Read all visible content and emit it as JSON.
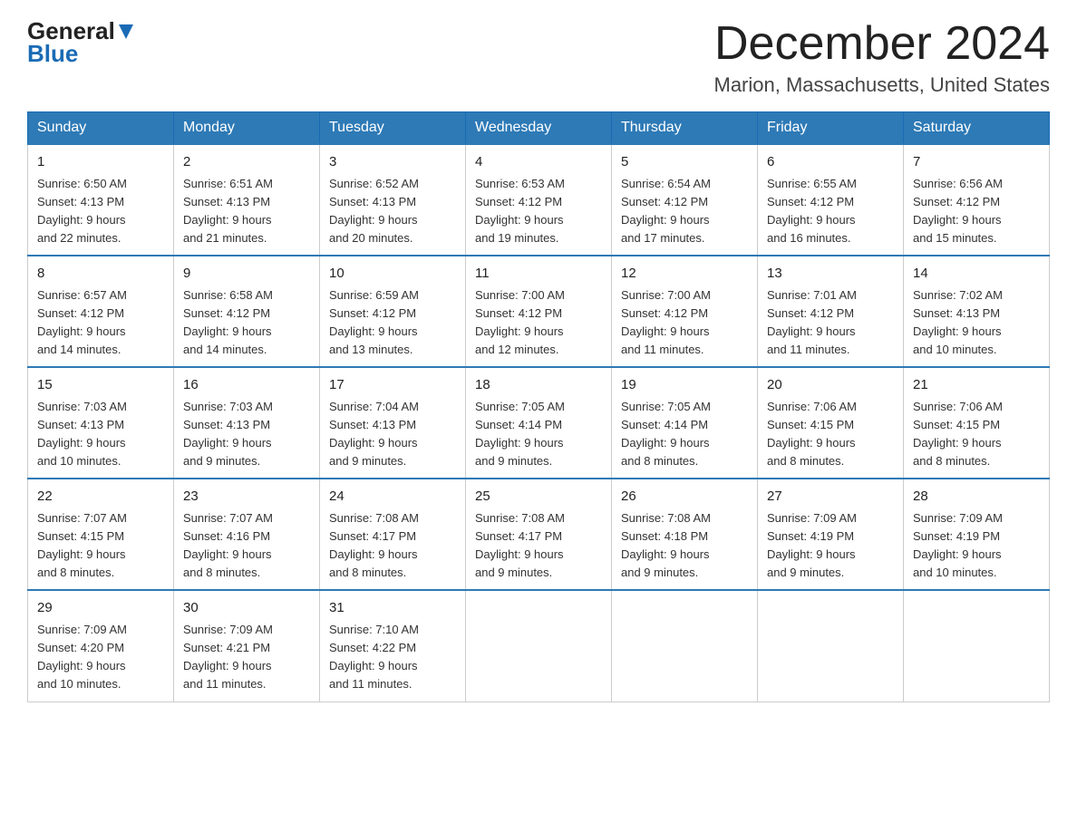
{
  "header": {
    "logo_general": "General",
    "logo_blue": "Blue",
    "month_title": "December 2024",
    "location": "Marion, Massachusetts, United States"
  },
  "days_of_week": [
    "Sunday",
    "Monday",
    "Tuesday",
    "Wednesday",
    "Thursday",
    "Friday",
    "Saturday"
  ],
  "weeks": [
    [
      {
        "day": "1",
        "sunrise": "6:50 AM",
        "sunset": "4:13 PM",
        "daylight": "9 hours and 22 minutes."
      },
      {
        "day": "2",
        "sunrise": "6:51 AM",
        "sunset": "4:13 PM",
        "daylight": "9 hours and 21 minutes."
      },
      {
        "day": "3",
        "sunrise": "6:52 AM",
        "sunset": "4:13 PM",
        "daylight": "9 hours and 20 minutes."
      },
      {
        "day": "4",
        "sunrise": "6:53 AM",
        "sunset": "4:12 PM",
        "daylight": "9 hours and 19 minutes."
      },
      {
        "day": "5",
        "sunrise": "6:54 AM",
        "sunset": "4:12 PM",
        "daylight": "9 hours and 17 minutes."
      },
      {
        "day": "6",
        "sunrise": "6:55 AM",
        "sunset": "4:12 PM",
        "daylight": "9 hours and 16 minutes."
      },
      {
        "day": "7",
        "sunrise": "6:56 AM",
        "sunset": "4:12 PM",
        "daylight": "9 hours and 15 minutes."
      }
    ],
    [
      {
        "day": "8",
        "sunrise": "6:57 AM",
        "sunset": "4:12 PM",
        "daylight": "9 hours and 14 minutes."
      },
      {
        "day": "9",
        "sunrise": "6:58 AM",
        "sunset": "4:12 PM",
        "daylight": "9 hours and 14 minutes."
      },
      {
        "day": "10",
        "sunrise": "6:59 AM",
        "sunset": "4:12 PM",
        "daylight": "9 hours and 13 minutes."
      },
      {
        "day": "11",
        "sunrise": "7:00 AM",
        "sunset": "4:12 PM",
        "daylight": "9 hours and 12 minutes."
      },
      {
        "day": "12",
        "sunrise": "7:00 AM",
        "sunset": "4:12 PM",
        "daylight": "9 hours and 11 minutes."
      },
      {
        "day": "13",
        "sunrise": "7:01 AM",
        "sunset": "4:12 PM",
        "daylight": "9 hours and 11 minutes."
      },
      {
        "day": "14",
        "sunrise": "7:02 AM",
        "sunset": "4:13 PM",
        "daylight": "9 hours and 10 minutes."
      }
    ],
    [
      {
        "day": "15",
        "sunrise": "7:03 AM",
        "sunset": "4:13 PM",
        "daylight": "9 hours and 10 minutes."
      },
      {
        "day": "16",
        "sunrise": "7:03 AM",
        "sunset": "4:13 PM",
        "daylight": "9 hours and 9 minutes."
      },
      {
        "day": "17",
        "sunrise": "7:04 AM",
        "sunset": "4:13 PM",
        "daylight": "9 hours and 9 minutes."
      },
      {
        "day": "18",
        "sunrise": "7:05 AM",
        "sunset": "4:14 PM",
        "daylight": "9 hours and 9 minutes."
      },
      {
        "day": "19",
        "sunrise": "7:05 AM",
        "sunset": "4:14 PM",
        "daylight": "9 hours and 8 minutes."
      },
      {
        "day": "20",
        "sunrise": "7:06 AM",
        "sunset": "4:15 PM",
        "daylight": "9 hours and 8 minutes."
      },
      {
        "day": "21",
        "sunrise": "7:06 AM",
        "sunset": "4:15 PM",
        "daylight": "9 hours and 8 minutes."
      }
    ],
    [
      {
        "day": "22",
        "sunrise": "7:07 AM",
        "sunset": "4:15 PM",
        "daylight": "9 hours and 8 minutes."
      },
      {
        "day": "23",
        "sunrise": "7:07 AM",
        "sunset": "4:16 PM",
        "daylight": "9 hours and 8 minutes."
      },
      {
        "day": "24",
        "sunrise": "7:08 AM",
        "sunset": "4:17 PM",
        "daylight": "9 hours and 8 minutes."
      },
      {
        "day": "25",
        "sunrise": "7:08 AM",
        "sunset": "4:17 PM",
        "daylight": "9 hours and 9 minutes."
      },
      {
        "day": "26",
        "sunrise": "7:08 AM",
        "sunset": "4:18 PM",
        "daylight": "9 hours and 9 minutes."
      },
      {
        "day": "27",
        "sunrise": "7:09 AM",
        "sunset": "4:19 PM",
        "daylight": "9 hours and 9 minutes."
      },
      {
        "day": "28",
        "sunrise": "7:09 AM",
        "sunset": "4:19 PM",
        "daylight": "9 hours and 10 minutes."
      }
    ],
    [
      {
        "day": "29",
        "sunrise": "7:09 AM",
        "sunset": "4:20 PM",
        "daylight": "9 hours and 10 minutes."
      },
      {
        "day": "30",
        "sunrise": "7:09 AM",
        "sunset": "4:21 PM",
        "daylight": "9 hours and 11 minutes."
      },
      {
        "day": "31",
        "sunrise": "7:10 AM",
        "sunset": "4:22 PM",
        "daylight": "9 hours and 11 minutes."
      },
      null,
      null,
      null,
      null
    ]
  ]
}
